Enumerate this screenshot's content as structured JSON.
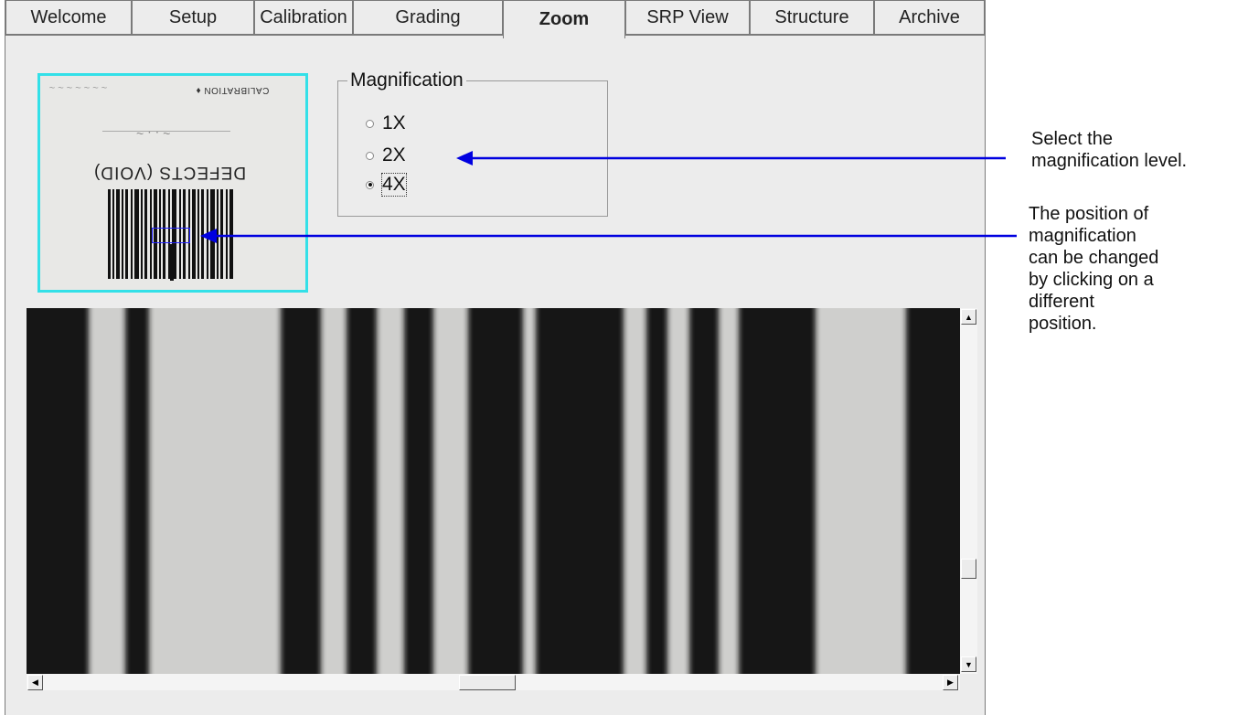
{
  "tabs": [
    {
      "label": "Welcome",
      "active": false
    },
    {
      "label": "Setup",
      "active": false
    },
    {
      "label": "Calibration",
      "active": false
    },
    {
      "label": "Grading",
      "active": false
    },
    {
      "label": "Zoom",
      "active": true
    },
    {
      "label": "SRP View",
      "active": false
    },
    {
      "label": "Structure",
      "active": false
    },
    {
      "label": "Archive",
      "active": false
    }
  ],
  "thumbnail": {
    "top_text": "CALIBRATION ♦",
    "label_text": "DEFECTS (VOID)",
    "border_color": "#33e0e8",
    "selection_color": "#2020ff"
  },
  "magnification": {
    "legend": "Magnification",
    "options": [
      {
        "label": "1X",
        "selected": false
      },
      {
        "label": "2X",
        "selected": false
      },
      {
        "label": "4X",
        "selected": true
      }
    ]
  },
  "annotations": {
    "select_level": [
      "Select the",
      "magnification level."
    ],
    "position_note": [
      "The position of",
      "magnification",
      "can be changed",
      "by clicking on a",
      "different",
      "position."
    ],
    "arrow_color": "#0000e0"
  },
  "scroll_icons": {
    "up": "arrow-up-icon",
    "down": "arrow-down-icon",
    "left": "arrow-left-icon",
    "right": "arrow-right-icon"
  }
}
